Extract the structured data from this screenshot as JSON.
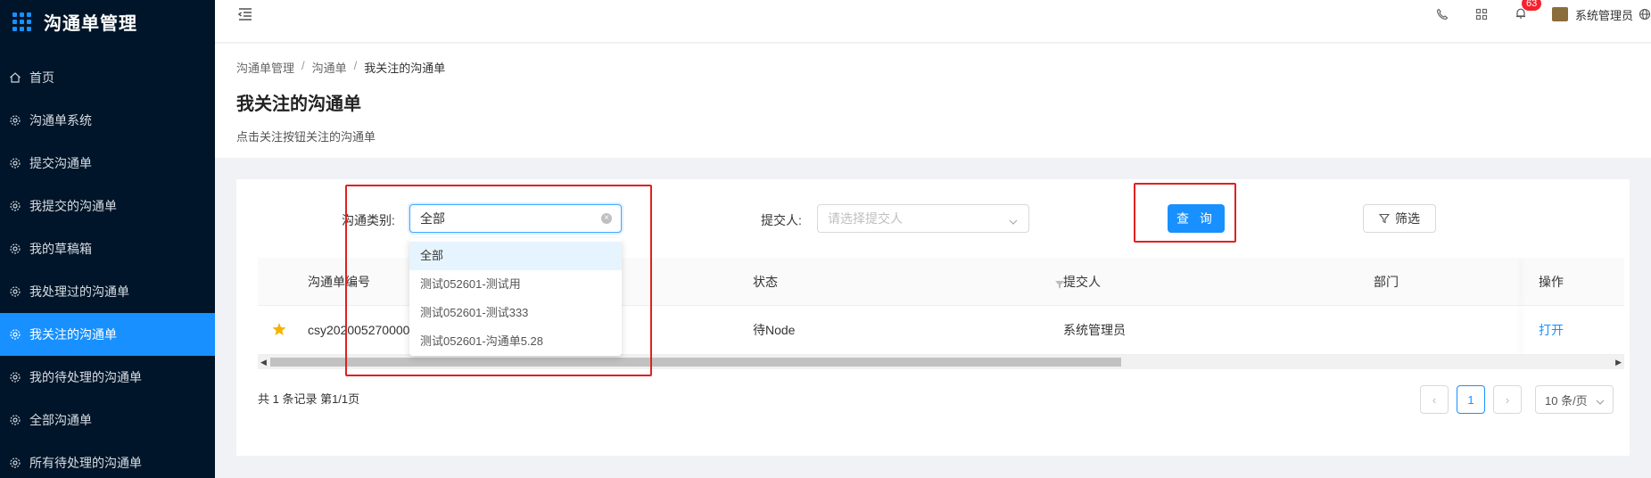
{
  "app": {
    "title": "沟通单管理"
  },
  "sidebar": {
    "items": [
      {
        "label": "首页",
        "icon": "home-icon"
      },
      {
        "label": "沟通单系统",
        "icon": "gear-icon"
      },
      {
        "label": "提交沟通单",
        "icon": "gear-icon"
      },
      {
        "label": "我提交的沟通单",
        "icon": "gear-icon"
      },
      {
        "label": "我的草稿箱",
        "icon": "gear-icon"
      },
      {
        "label": "我处理过的沟通单",
        "icon": "gear-icon"
      },
      {
        "label": "我关注的沟通单",
        "icon": "gear-icon",
        "active": true
      },
      {
        "label": "我的待处理的沟通单",
        "icon": "gear-icon"
      },
      {
        "label": "全部沟通单",
        "icon": "gear-icon"
      },
      {
        "label": "所有待处理的沟通单",
        "icon": "gear-icon"
      }
    ]
  },
  "header": {
    "notification_count": "63",
    "user_name": "系统管理员"
  },
  "breadcrumb": [
    "沟通单管理",
    "沟通单",
    "我关注的沟通单"
  ],
  "page": {
    "title": "我关注的沟通单",
    "description": "点击关注按钮关注的沟通单"
  },
  "filters": {
    "category_label": "沟通类别:",
    "category_value": "全部",
    "submitter_label": "提交人:",
    "submitter_placeholder": "请选择提交人",
    "query_button": "查 询",
    "filter_button": "筛选"
  },
  "dropdown": {
    "options": [
      "全部",
      "测试052601-测试用",
      "测试052601-测试333",
      "测试052601-沟通单5.28"
    ],
    "selected_index": 0
  },
  "table": {
    "columns": [
      "沟通单编号",
      "状态",
      "提交人",
      "部门",
      "操作"
    ],
    "rows": [
      {
        "id": "csy2020052700002",
        "status": "待Node",
        "submitter": "系统管理员",
        "department": "",
        "action": "打开",
        "starred": true
      }
    ]
  },
  "pagination": {
    "summary": "共 1 条记录 第1/1页",
    "current_page": "1",
    "page_size": "10 条/页"
  },
  "colors": {
    "sidebar_bg": "#001529",
    "primary": "#1890ff",
    "highlight_box": "#e02020",
    "star": "#f5b301"
  }
}
